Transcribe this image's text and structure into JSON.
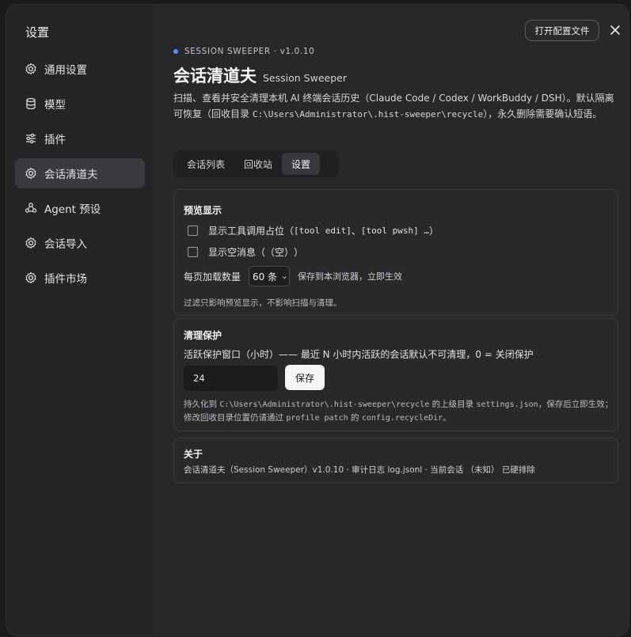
{
  "window": {
    "sidebar_title": "设置",
    "open_config_label": "打开配置文件",
    "close_icon": "close-icon"
  },
  "sidebar": {
    "items": [
      {
        "label": "通用设置",
        "icon": "gear-icon",
        "active": false
      },
      {
        "label": "模型",
        "icon": "database-icon",
        "active": false
      },
      {
        "label": "插件",
        "icon": "sliders-icon",
        "active": false
      },
      {
        "label": "会话清道夫",
        "icon": "gear-icon",
        "active": true
      },
      {
        "label": "Agent 预设",
        "icon": "people-icon",
        "active": false
      },
      {
        "label": "会话导入",
        "icon": "gear-icon",
        "active": false
      },
      {
        "label": "插件市场",
        "icon": "gear-icon",
        "active": false
      }
    ]
  },
  "header": {
    "eyebrow": "SESSION SWEEPER · v1.0.10",
    "title": "会话清道夫",
    "subtitle": "Session Sweeper",
    "desc_part1": "扫描、查看并安全清理本机 AI 终端会话历史（Claude Code / Codex / WorkBuddy / DSH）。默认隔离可恢复（回收目录 ",
    "desc_path": "C:\\Users\\Administrator\\.hist-sweeper\\recycle",
    "desc_part2": "），永久删除需要确认短语。",
    "accent_color": "#5b8cff"
  },
  "tabs": [
    {
      "label": "会话列表",
      "active": false
    },
    {
      "label": "回收站",
      "active": false
    },
    {
      "label": "设置",
      "active": true
    }
  ],
  "preview": {
    "title": "预览显示",
    "check1_label": "显示工具调用占位（",
    "check1_code1": "[tool edit]",
    "check1_sep": " 、 ",
    "check1_code2": "[tool pwsh] …",
    "check1_end": "）",
    "check1_checked": false,
    "check2_label": "显示空消息（",
    "check2_code": "（空）",
    "check2_end": "）",
    "check2_checked": false,
    "page_size_label": "每页加载数量",
    "page_size_value": "60 条",
    "page_size_note": "保存到本浏览器，立即生效",
    "hint": "过滤只影响预览显示，不影响扫描与清理。"
  },
  "protection": {
    "title": "清理保护",
    "window_label": "活跃保护窗口（小时）—— 最近 N 小时内活跃的会话默认不可清理，0 = 关闭保护",
    "window_value": "24",
    "save_label": "保存",
    "hint_part1": "持久化到 ",
    "hint_path": "C:\\Users\\Administrator\\.hist-sweeper\\recycle",
    "hint_part2": " 的上级目录 ",
    "hint_file": "settings.json",
    "hint_part3": "，保存后立即生效；修改回收目录位置仍请通过 ",
    "hint_cmd": "profile patch",
    "hint_part4": " 的 ",
    "hint_key": "config.recycleDir",
    "hint_part5": "。"
  },
  "about": {
    "title": "关于",
    "text": "会话清道夫（Session Sweeper）v1.0.10 · 审计日志 log.jsonl · 当前会话 （未知） 已硬排除"
  }
}
